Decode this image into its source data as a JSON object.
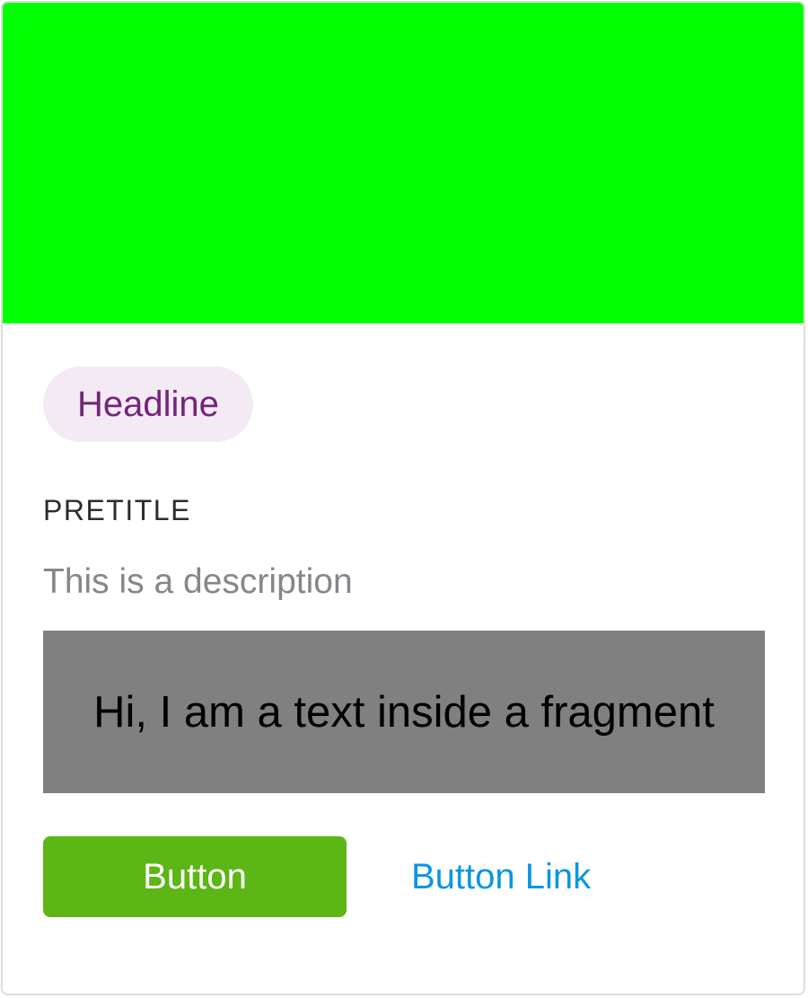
{
  "card": {
    "media_color": "#00ff00",
    "tag": {
      "label": "Headline",
      "background": "#f4eaf4",
      "text_color": "#73257a"
    },
    "pretitle": "PRETITLE",
    "description": "This is a description",
    "fragment": {
      "text": "Hi, I am a text inside a fragment",
      "background": "#808080"
    },
    "primary_button": {
      "label": "Button",
      "background": "#5cb615"
    },
    "link_button": {
      "label": "Button Link",
      "color": "#0b96e1"
    }
  }
}
